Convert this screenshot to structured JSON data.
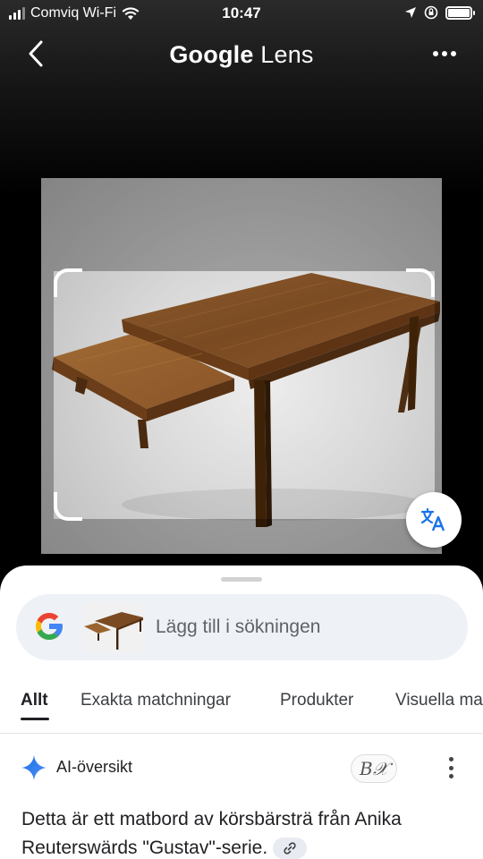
{
  "status_bar": {
    "carrier": "Comviq Wi-Fi",
    "time": "10:47"
  },
  "header": {
    "title_brand": "Google",
    "title_product": "Lens"
  },
  "search": {
    "placeholder": "Lägg till i sökningen"
  },
  "tabs": [
    {
      "label": "Allt"
    },
    {
      "label": "Exakta matchningar"
    },
    {
      "label": "Produkter"
    },
    {
      "label": "Visuella matchningar"
    }
  ],
  "ai_overview": {
    "label": "AI-översikt",
    "source_badge": "B𝒳",
    "answer": "Detta är ett matbord av körsbärsträ från Anika Reuterswärds \"Gustav\"-serie."
  },
  "colors": {
    "accent_blue": "#1a73e8",
    "google_red": "#ea4335",
    "google_yellow": "#fbbc05",
    "google_green": "#34a853",
    "wood": "#7a4a22"
  }
}
